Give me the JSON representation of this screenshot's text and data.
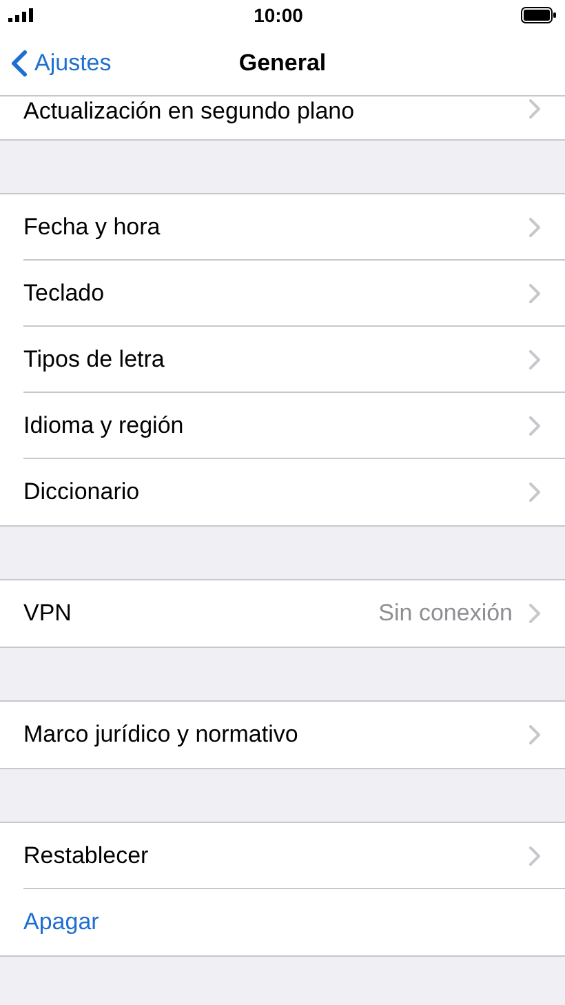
{
  "status_bar": {
    "time": "10:00"
  },
  "nav_bar": {
    "back_label": "Ajustes",
    "title": "General"
  },
  "groups": [
    {
      "partial": true,
      "rows": [
        {
          "kind": "link",
          "label": "Actualización en segundo plano"
        }
      ]
    },
    {
      "partial": false,
      "rows": [
        {
          "kind": "link",
          "label": "Fecha y hora"
        },
        {
          "kind": "link",
          "label": "Teclado"
        },
        {
          "kind": "link",
          "label": "Tipos de letra"
        },
        {
          "kind": "link",
          "label": "Idioma y región"
        },
        {
          "kind": "link",
          "label": "Diccionario"
        }
      ]
    },
    {
      "partial": false,
      "rows": [
        {
          "kind": "link",
          "label": "VPN",
          "detail": "Sin conexión"
        }
      ]
    },
    {
      "partial": false,
      "rows": [
        {
          "kind": "link",
          "label": "Marco jurídico y normativo"
        }
      ]
    },
    {
      "partial": false,
      "rows": [
        {
          "kind": "link",
          "label": "Restablecer"
        },
        {
          "kind": "action",
          "label": "Apagar"
        }
      ]
    }
  ]
}
